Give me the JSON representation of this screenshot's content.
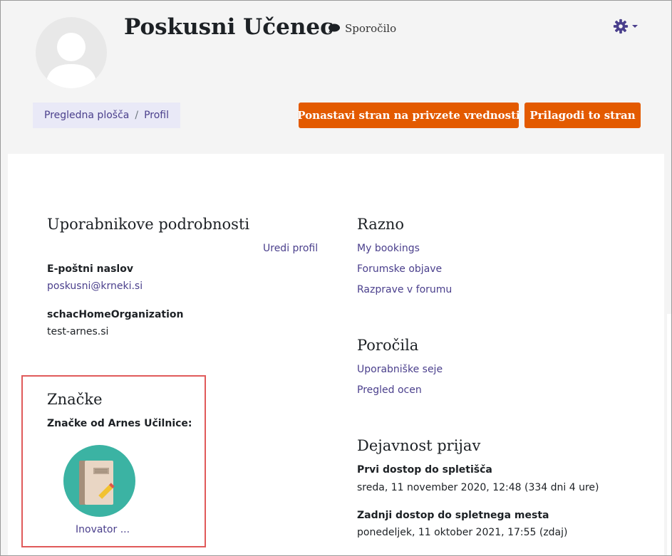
{
  "header": {
    "user_name": "Poskusni Učenec",
    "message_label": "Sporočilo",
    "icons": {
      "avatar": "user-avatar-placeholder",
      "message": "speech-bubble-icon",
      "settings": "gear-icon"
    }
  },
  "breadcrumb": {
    "items": [
      "Pregledna plošča",
      "Profil"
    ],
    "separator": "/"
  },
  "actions": {
    "reset_label": "Ponastavi stran na privzete vrednosti",
    "customize_label": "Prilagodi to stran"
  },
  "user_details": {
    "title": "Uporabnikove podrobnosti",
    "edit_label": "Uredi profil",
    "email_label": "E-poštni naslov",
    "email_value": "poskusni@krneki.si",
    "org_label": "schacHomeOrganization",
    "org_value": "test-arnes.si"
  },
  "badges": {
    "title": "Značke",
    "subtitle": "Značke od Arnes Učilnice:",
    "items": [
      {
        "name": "Inovator ...",
        "icon": "notebook-pencil-icon"
      }
    ]
  },
  "misc": {
    "title": "Razno",
    "links": [
      "My bookings",
      "Forumske objave",
      "Razprave v forumu"
    ]
  },
  "reports": {
    "title": "Poročila",
    "links": [
      "Uporabniške seje",
      "Pregled ocen"
    ]
  },
  "login_activity": {
    "title": "Dejavnost prijav",
    "first_access_label": "Prvi dostop do spletišča",
    "first_access_value": "sreda, 11 november 2020, 12:48  (334 dni 4 ure)",
    "last_access_label": "Zadnji dostop do spletnega mesta",
    "last_access_value": "ponedeljek, 11 oktober 2021, 17:55  (zdaj)"
  },
  "colors": {
    "accent_button": "#e35a00",
    "link": "#4a3f8c",
    "settings_icon": "#4a3f8c",
    "header_bg": "#f4f4f4",
    "breadcrumb_bg": "#e9e9f7",
    "badge_bg": "#3bb3a3",
    "highlight_border": "#e05a5a"
  }
}
